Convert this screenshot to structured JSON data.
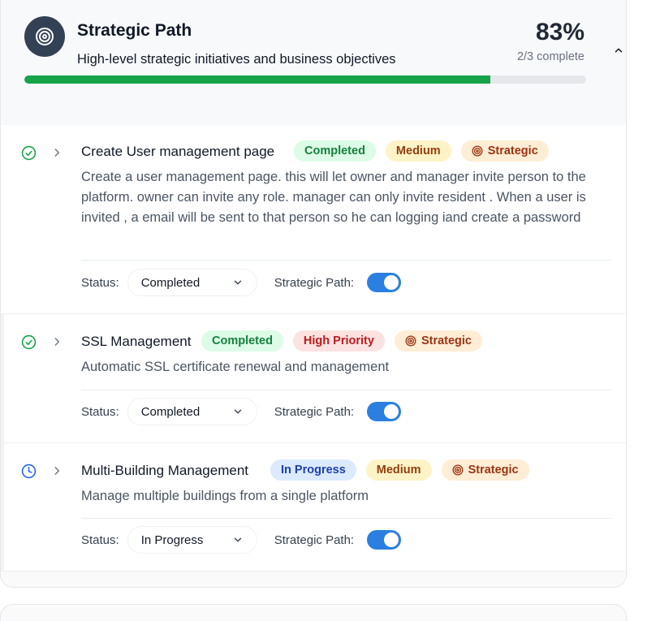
{
  "header": {
    "title": "Strategic Path",
    "subtitle": "High-level strategic initiatives and business objectives",
    "percent": "83%",
    "progress_text": "2/3 complete",
    "progress_fraction": 0.83,
    "icon": "target-icon",
    "collapse_icon": "chevron-up-icon"
  },
  "labels": {
    "status": "Status:",
    "strategic_path": "Strategic Path:"
  },
  "items": [
    {
      "title": "Create User management page",
      "status_icon": "check-circle-icon",
      "badges": {
        "status": "Completed",
        "priority": "Medium",
        "strategic": "Strategic"
      },
      "description": "Create a user management page. this will let owner and manager invite person to the platform. owner can invite any role. manager can only invite resident . When a user is invited , a email will be sent to that person so he can logging iand create a password",
      "status_value": "Completed",
      "strategic_path_on": true
    },
    {
      "title": "SSL Management",
      "status_icon": "check-circle-icon",
      "badges": {
        "status": "Completed",
        "priority": "High Priority",
        "strategic": "Strategic"
      },
      "description": "Automatic SSL certificate renewal and management",
      "status_value": "Completed",
      "strategic_path_on": true
    },
    {
      "title": "Multi-Building Management",
      "status_icon": "clock-icon",
      "badges": {
        "status": "In Progress",
        "priority": "Medium",
        "strategic": "Strategic"
      },
      "description": "Manage multiple buildings from a single platform",
      "status_value": "In Progress",
      "strategic_path_on": true
    }
  ],
  "colors": {
    "progress": "#16a34a",
    "toggle_on": "#2b7fe0",
    "completed_icon": "#16a34a",
    "in_progress_icon": "#2563eb"
  }
}
